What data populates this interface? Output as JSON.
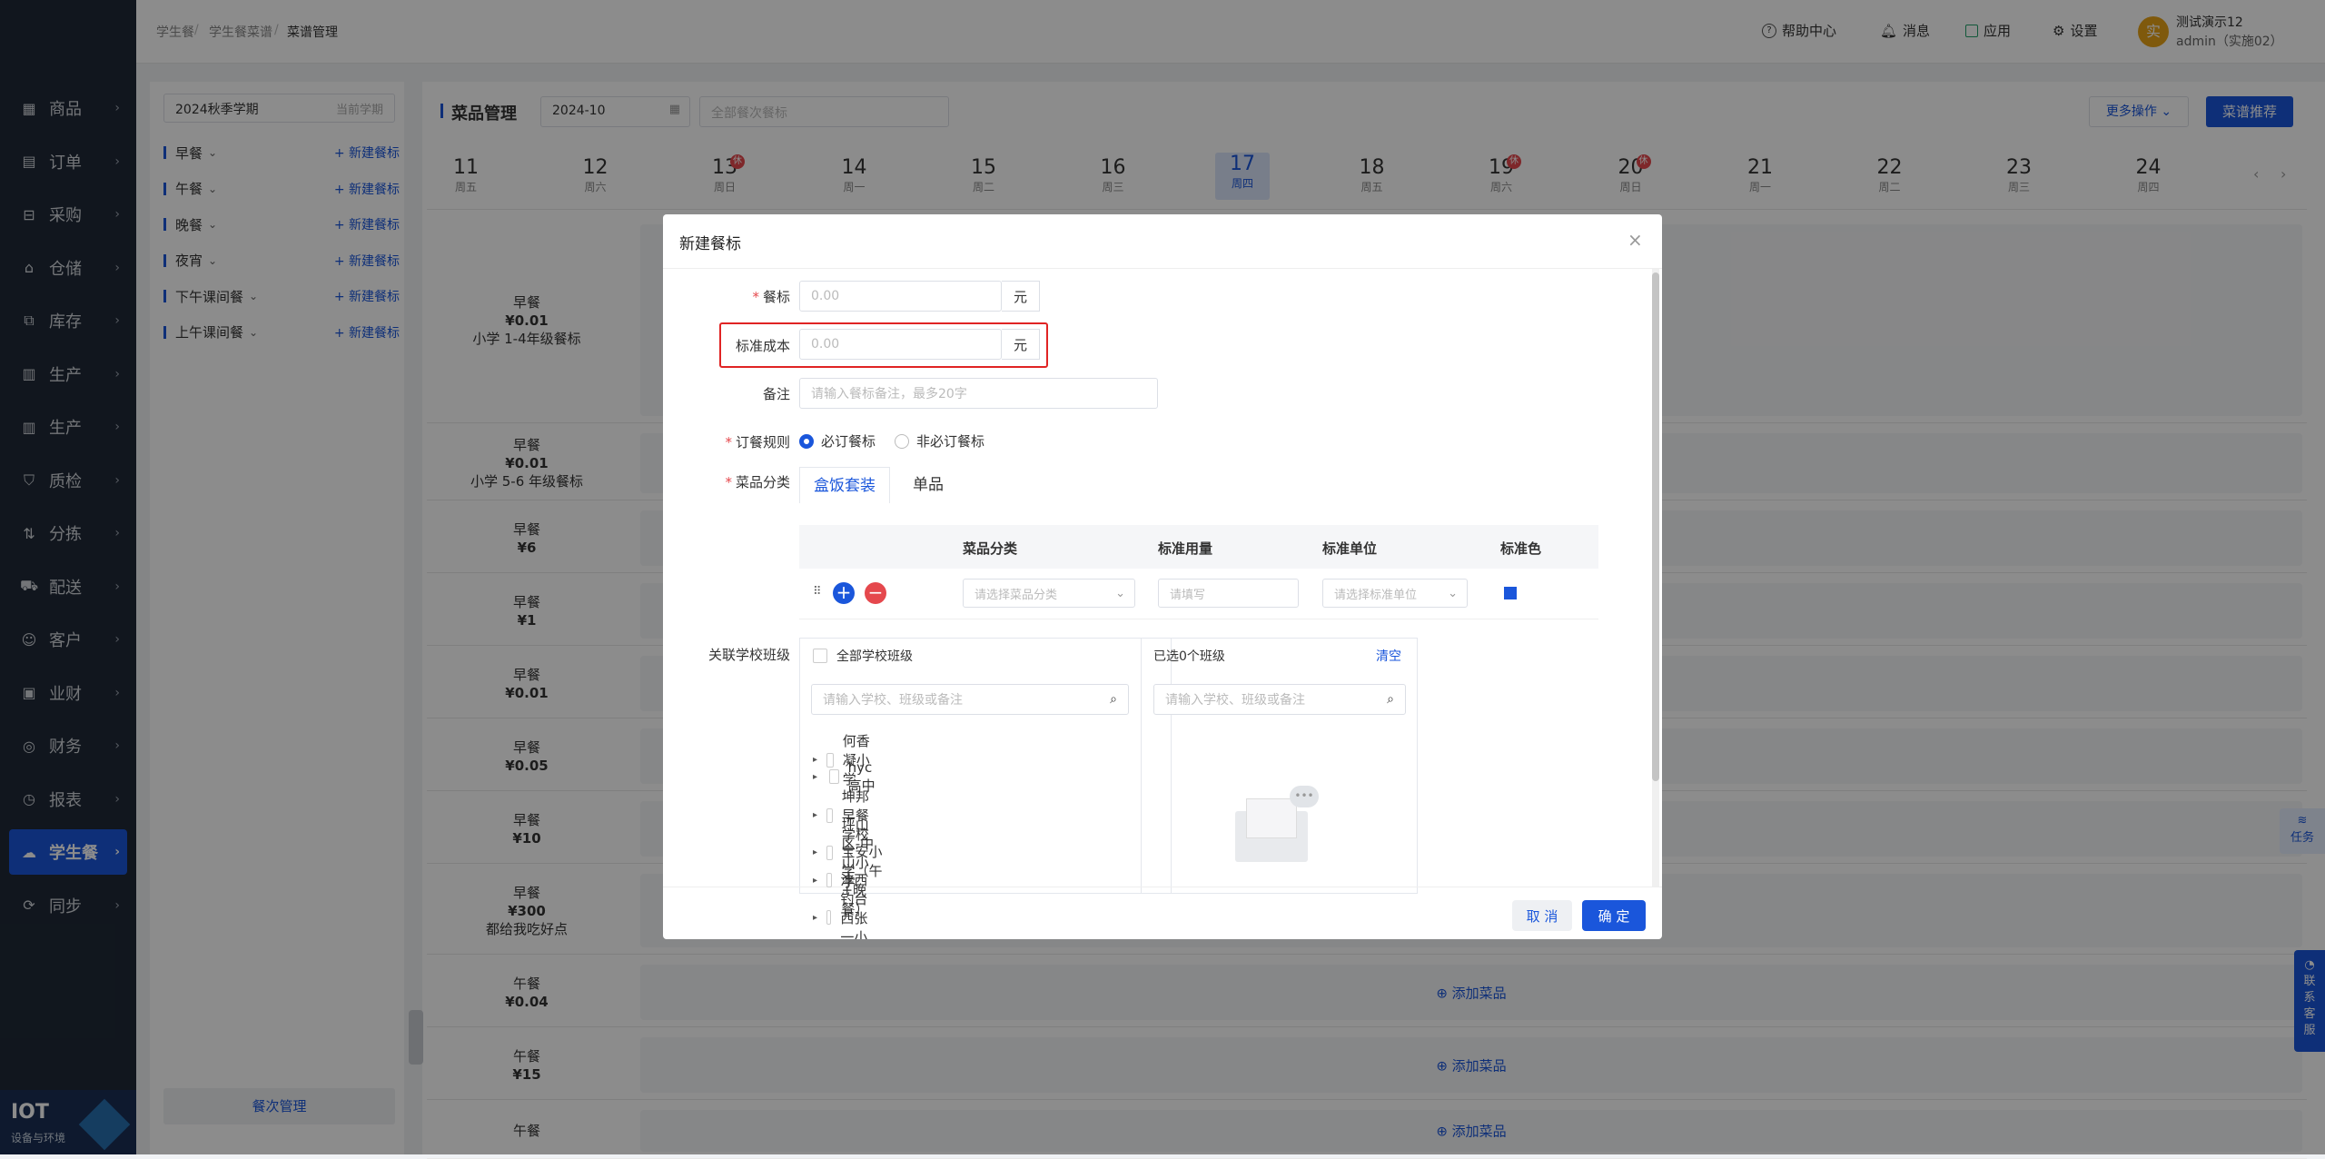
{
  "breadcrumb": [
    "学生餐",
    "学生餐菜谱",
    "菜谱管理"
  ],
  "topnav": {
    "help": "帮助中心",
    "message": "消息",
    "apps": "应用",
    "settings": "设置",
    "user_name": "测试演示12",
    "user_role": "admin（实施02）",
    "avatar_text": "实"
  },
  "sidebar": {
    "items": [
      {
        "label": "商品",
        "icon": "grid-icon"
      },
      {
        "label": "订单",
        "icon": "clipboard-icon"
      },
      {
        "label": "采购",
        "icon": "basket-icon"
      },
      {
        "label": "仓储",
        "icon": "warehouse-icon"
      },
      {
        "label": "库存",
        "icon": "box-icon"
      },
      {
        "label": "生产",
        "icon": "factory-icon"
      },
      {
        "label": "生产",
        "icon": "factory-icon"
      },
      {
        "label": "质检",
        "icon": "shield-icon"
      },
      {
        "label": "分拣",
        "icon": "sort-icon"
      },
      {
        "label": "配送",
        "icon": "truck-icon"
      },
      {
        "label": "客户",
        "icon": "user-icon"
      },
      {
        "label": "业财",
        "icon": "chart-icon"
      },
      {
        "label": "财务",
        "icon": "finance-icon"
      },
      {
        "label": "报表",
        "icon": "clock-icon"
      },
      {
        "label": "学生餐",
        "icon": "cloud-icon"
      },
      {
        "label": "同步",
        "icon": "sync-icon"
      }
    ],
    "active_index": 14
  },
  "brand": {
    "title": "IOT",
    "subtitle": "设备与环境"
  },
  "left_panel": {
    "semester": "2024秋季学期",
    "semester_tag": "当前学期",
    "meals": [
      "早餐",
      "午餐",
      "晚餐",
      "夜宵",
      "下午课间餐",
      "上午课间餐"
    ],
    "add_label": "+ 新建餐标",
    "footer": "餐次管理"
  },
  "main": {
    "title": "菜品管理",
    "month": "2024-10",
    "meal_filter_placeholder": "全部餐次餐标",
    "more_ops": "更多操作",
    "recommend": "菜谱推荐",
    "add_dish": "添加菜品"
  },
  "days": [
    {
      "num": "11",
      "wd": "周五",
      "hol": ""
    },
    {
      "num": "12",
      "wd": "周六",
      "hol": ""
    },
    {
      "num": "13",
      "wd": "周日",
      "hol": "休"
    },
    {
      "num": "14",
      "wd": "周一",
      "hol": ""
    },
    {
      "num": "15",
      "wd": "周二",
      "hol": ""
    },
    {
      "num": "16",
      "wd": "周三",
      "hol": ""
    },
    {
      "num": "17",
      "wd": "周四",
      "hol": ""
    },
    {
      "num": "18",
      "wd": "周五",
      "hol": ""
    },
    {
      "num": "19",
      "wd": "周六",
      "hol": "休"
    },
    {
      "num": "20",
      "wd": "周日",
      "hol": "休"
    },
    {
      "num": "21",
      "wd": "周一",
      "hol": ""
    },
    {
      "num": "22",
      "wd": "周二",
      "hol": ""
    },
    {
      "num": "23",
      "wd": "周三",
      "hol": ""
    },
    {
      "num": "24",
      "wd": "周四",
      "hol": ""
    }
  ],
  "rows": [
    {
      "meal": "早餐",
      "price": "¥0.01",
      "desc": "小学 1-4年级餐标"
    },
    {
      "meal": "早餐",
      "price": "¥0.01",
      "desc": "小学 5-6 年级餐标"
    },
    {
      "meal": "早餐",
      "price": "¥6",
      "desc": ""
    },
    {
      "meal": "早餐",
      "price": "¥1",
      "desc": ""
    },
    {
      "meal": "早餐",
      "price": "¥0.01",
      "desc": ""
    },
    {
      "meal": "早餐",
      "price": "¥0.05",
      "desc": ""
    },
    {
      "meal": "早餐",
      "price": "¥10",
      "desc": ""
    },
    {
      "meal": "早餐",
      "price": "¥300",
      "desc": "都给我吃好点"
    },
    {
      "meal": "午餐",
      "price": "¥0.04",
      "desc": ""
    },
    {
      "meal": "午餐",
      "price": "¥15",
      "desc": ""
    },
    {
      "meal": "午餐",
      "price": "",
      "desc": ""
    }
  ],
  "modal": {
    "title": "新建餐标",
    "label_price": "餐标",
    "placeholder_price": "0.00",
    "unit": "元",
    "label_cost": "标准成本",
    "placeholder_cost": "0.00",
    "label_note": "备注",
    "placeholder_note": "请输入餐标备注，最多20字",
    "label_rule": "订餐规则",
    "rule_required": "必订餐标",
    "rule_optional": "非必订餐标",
    "label_category": "菜品分类",
    "tab_box": "盒饭套装",
    "tab_single": "单品",
    "table_headers": [
      "菜品分类",
      "标准用量",
      "标准单位",
      "标准色"
    ],
    "ph_category": "请选择菜品分类",
    "ph_amount": "请填写",
    "ph_unit": "请选择标准单位",
    "std_color": "#1a56db",
    "label_schools": "关联学校班级",
    "all_classes": "全部学校班级",
    "selected": "已选0个班级",
    "clear": "清空",
    "ph_search": "请输入学校、班级或备注",
    "schools": [
      "何香凝小学",
      "hyc高中",
      "坤邦早餐学校",
      "坪山区-中山小学",
      "宝安小学（午+晚餐）",
      "沣西钓台西张一小学"
    ],
    "cancel": "取 消",
    "ok": "确 定"
  },
  "side_widgets": {
    "task": "任务",
    "contact": "联系客服"
  }
}
